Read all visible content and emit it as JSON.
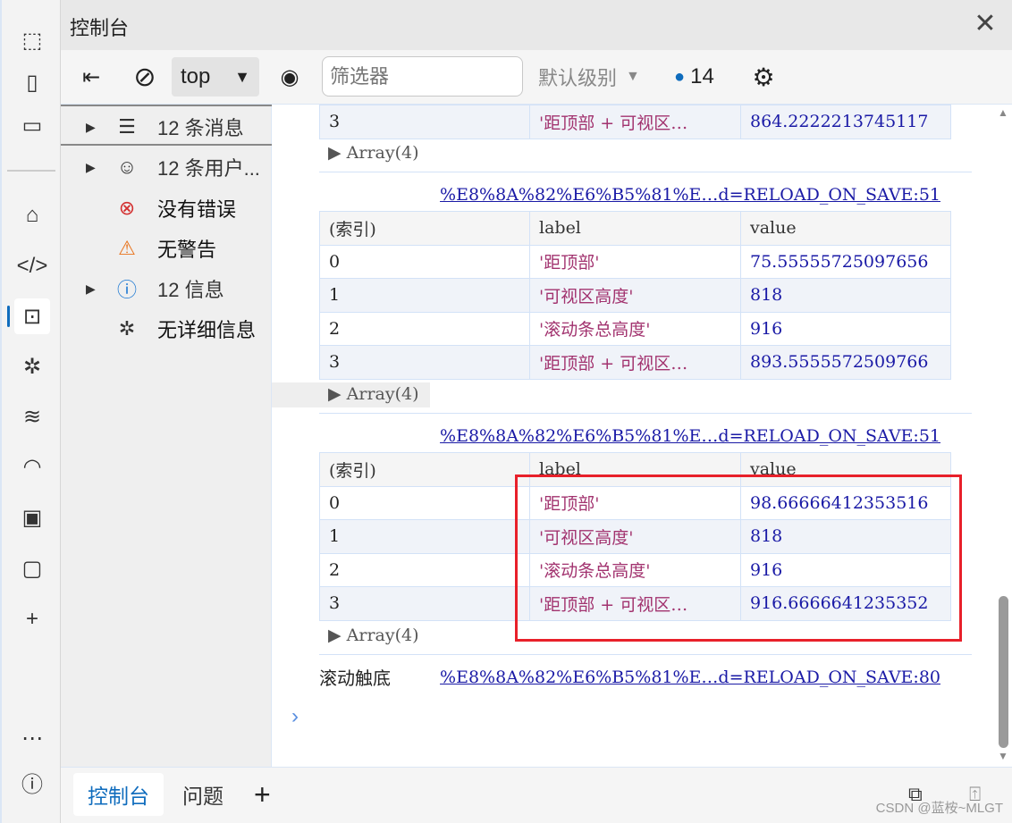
{
  "title": "控制台",
  "toolbar": {
    "context": "top",
    "filter_placeholder": "筛选器",
    "level": "默认级别",
    "message_count": "14"
  },
  "sidebar": {
    "items": [
      {
        "label": "12 条消息",
        "icon": "list-icon",
        "expandable": true
      },
      {
        "label": "12 条用户...",
        "icon": "user-icon",
        "expandable": true
      },
      {
        "label": "没有错误",
        "icon": "error-icon",
        "expandable": false
      },
      {
        "label": "无警告",
        "icon": "warning-icon",
        "expandable": false
      },
      {
        "label": "12 信息",
        "icon": "info-icon",
        "expandable": true
      },
      {
        "label": "无详细信息",
        "icon": "bug-icon",
        "expandable": false
      }
    ]
  },
  "console": {
    "table1_partial": {
      "row": [
        "3",
        "'距顶部 + 可视区…",
        "864.2222213745117"
      ]
    },
    "array_label": "Array(4)",
    "source_link": "%E8%8A%82%E6%B5%81%E…d=RELOAD_ON_SAVE:51",
    "headers": [
      "(索引)",
      "label",
      "value"
    ],
    "table2": [
      [
        "0",
        "'距顶部'",
        "75.55555725097656"
      ],
      [
        "1",
        "'可视区高度'",
        "818"
      ],
      [
        "2",
        "'滚动条总高度'",
        "916"
      ],
      [
        "3",
        "'距顶部 + 可视区…",
        "893.5555572509766"
      ]
    ],
    "table3": [
      [
        "0",
        "'距顶部'",
        "98.66666412353516"
      ],
      [
        "1",
        "'可视区高度'",
        "818"
      ],
      [
        "2",
        "'滚动条总高度'",
        "916"
      ],
      [
        "3",
        "'距顶部 + 可视区…",
        "916.6666641235352"
      ]
    ],
    "log_message": "滚动触底",
    "log_link": "%E8%8A%82%E6%B5%81%E…d=RELOAD_ON_SAVE:80",
    "highlight_color": "#e8202a"
  },
  "bottom": {
    "tabs": [
      "控制台",
      "问题"
    ],
    "active": "控制台",
    "watermark": "CSDN @蓝桉~MLGT"
  }
}
